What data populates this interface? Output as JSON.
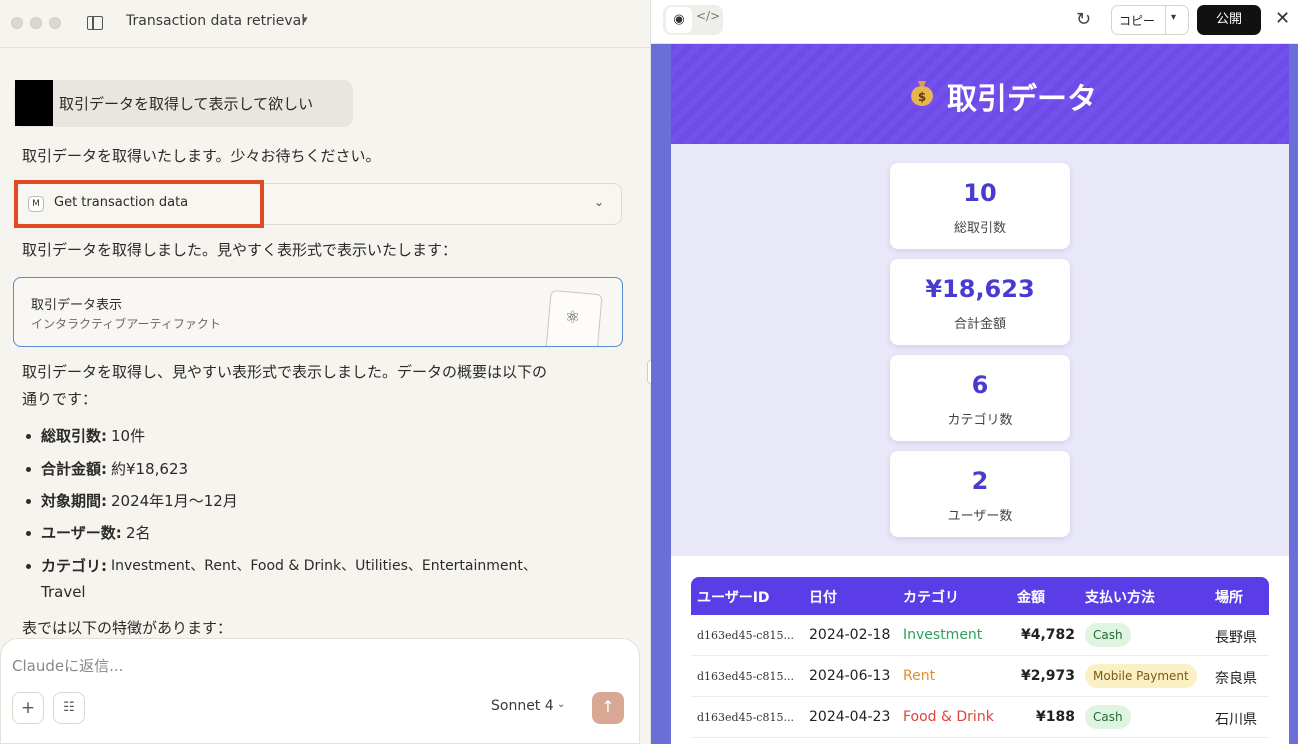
{
  "app": {
    "conversation_title": "Transaction data retrieval"
  },
  "chat": {
    "user_message": "取引データを取得して表示して欲しい",
    "reply_1": "取引データを取得いたします。少々お待ちください。",
    "tool": {
      "badge": "M",
      "label": "Get transaction data"
    },
    "reply_2": "取引データを取得しました。見やすく表形式で表示いたします：",
    "artifact": {
      "title": "取引データ表示",
      "subtitle": "インタラクティブアーティファクト"
    },
    "reply_3_line1": "取引データを取得し、見やすい表形式で表示しました。データの概要は以下の",
    "reply_3_line2": "通りです：",
    "bullets": [
      {
        "key": "総取引数:",
        "value": "10件"
      },
      {
        "key": "合計金額:",
        "value": "約¥18,623"
      },
      {
        "key": "対象期間:",
        "value": "2024年1月〜12月"
      },
      {
        "key": "ユーザー数:",
        "value": "2名"
      },
      {
        "key": "カテゴリ:",
        "value": "Investment、Rent、Food & Drink、Utilities、Entertainment、",
        "value_cont": "Travel"
      }
    ],
    "reply_4": "表では以下の特徴があります："
  },
  "composer": {
    "placeholder": "Claudeに返信...",
    "model": "Sonnet 4"
  },
  "preview_toolbar": {
    "copy_label": "コピー",
    "publish_label": "公開"
  },
  "dashboard": {
    "title": "取引データ",
    "stats": [
      {
        "value": "10",
        "label": "総取引数"
      },
      {
        "value": "¥18,623",
        "label": "合計金額"
      },
      {
        "value": "6",
        "label": "カテゴリ数"
      },
      {
        "value": "2",
        "label": "ユーザー数"
      }
    ],
    "table": {
      "headers": [
        "ユーザーID",
        "日付",
        "カテゴリ",
        "金額",
        "支払い方法",
        "場所"
      ],
      "rows": [
        {
          "user_id": "d163ed45-c815...",
          "date": "2024-02-18",
          "category": "Investment",
          "category_color": "#2f9e5a",
          "amount": "¥4,782",
          "payment": "Cash",
          "payment_bg": "#dff5e2",
          "location": "長野県"
        },
        {
          "user_id": "d163ed45-c815...",
          "date": "2024-06-13",
          "category": "Rent",
          "category_color": "#e0902a",
          "amount": "¥2,973",
          "payment": "Mobile Payment",
          "payment_bg": "#fbefc4",
          "location": "奈良県"
        },
        {
          "user_id": "d163ed45-c815...",
          "date": "2024-04-23",
          "category": "Food & Drink",
          "category_color": "#e0433a",
          "amount": "¥188",
          "payment": "Cash",
          "payment_bg": "#dff5e2",
          "location": "石川県"
        }
      ]
    }
  }
}
